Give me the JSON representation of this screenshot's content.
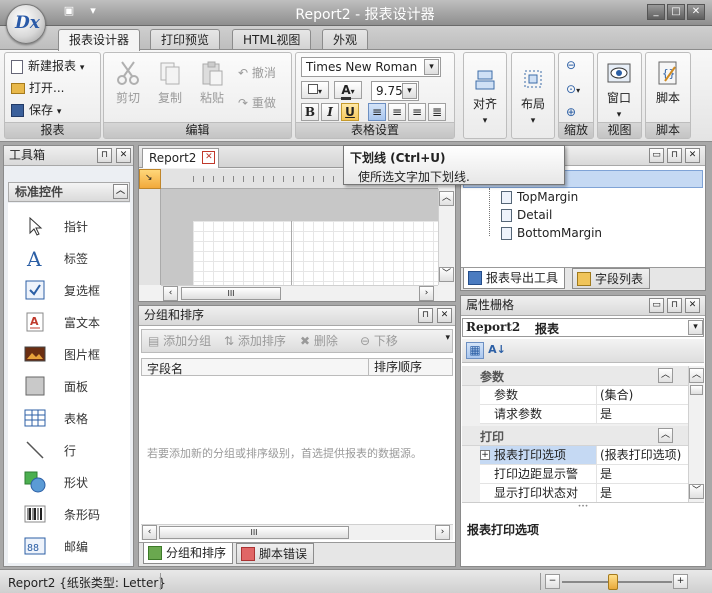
{
  "window": {
    "title": "Report2 - 报表设计器",
    "logo_text": "Dx"
  },
  "ribbon_tabs": [
    "报表设计器",
    "打印预览",
    "HTML视图",
    "外观"
  ],
  "groups": {
    "report": {
      "label": "报表",
      "new": "新建报表",
      "open": "打开...",
      "save": "保存"
    },
    "edit": {
      "label": "编辑",
      "cut": "剪切",
      "copy": "复制",
      "paste": "粘贴",
      "undo": "撤消",
      "redo": "重做"
    },
    "format": {
      "label": "表格设置",
      "font": "Times New Roman",
      "size": "9.75",
      "bold": "B",
      "italic": "I",
      "underline": "U"
    },
    "align": {
      "label": "对齐"
    },
    "layout": {
      "label": "布局"
    },
    "zoom": {
      "label": "缩放"
    },
    "view": {
      "label": "视图",
      "window": "窗口"
    },
    "script": {
      "label": "脚本",
      "button": "脚本"
    }
  },
  "tooltip": {
    "title": "下划线 (Ctrl+U)",
    "text": "使所选文字加下划线."
  },
  "toolbox": {
    "title": "工具箱",
    "section": "标准控件",
    "items": [
      "指针",
      "标签",
      "复选框",
      "富文本",
      "图片框",
      "面板",
      "表格",
      "行",
      "形状",
      "条形码",
      "邮编"
    ]
  },
  "document_tab": "Report2",
  "report_tree": {
    "items": [
      "TopMargin",
      "Detail",
      "BottomMargin"
    ],
    "tab_export": "报表导出工具",
    "tab_fields": "字段列表"
  },
  "group_sort": {
    "title": "分组和排序",
    "add_group": "添加分组",
    "add_sort": "添加排序",
    "delete": "删除",
    "move_down": "下移",
    "columns": [
      "字段名",
      "排序顺序"
    ],
    "empty_text": "若要添加新的分组或排序级别，首选提供报表的数据源。",
    "tab_group_sort": "分组和排序",
    "tab_script_errors": "脚本错误"
  },
  "properties": {
    "title": "属性栅格",
    "object_name": "Report2",
    "object_type": "报表",
    "categories": [
      {
        "name": "参数",
        "rows": [
          {
            "key": "参数",
            "value": "(集合)"
          },
          {
            "key": "请求参数",
            "value": "是"
          }
        ]
      },
      {
        "name": "打印",
        "rows": [
          {
            "key": "报表打印选项",
            "value": "(报表打印选项)"
          },
          {
            "key": "打印边距显示警",
            "value": "是"
          },
          {
            "key": "显示打印状态对",
            "value": "是"
          }
        ]
      }
    ],
    "description": "报表打印选项"
  },
  "status": {
    "text": "Report2 {纸张类型: Letter}"
  }
}
